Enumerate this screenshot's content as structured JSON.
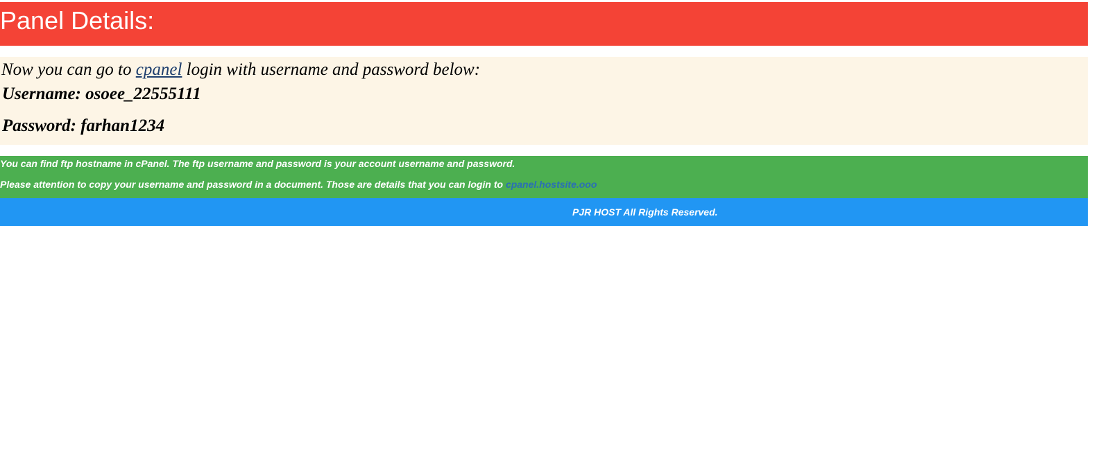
{
  "header": {
    "title": "Panel Details:"
  },
  "info": {
    "intro_prefix": "Now you can go to ",
    "intro_link": "cpanel",
    "intro_suffix": " login with username and password below:",
    "username_line": "Username: osoee_22555111",
    "password_line": "Password: farhan1234"
  },
  "notice": {
    "line1": "You can find ftp hostname in cPanel. The ftp username and password is your account username and password.",
    "line2_prefix": "Please attention to copy your username and password in a document. Those are details that you can login to ",
    "line2_link": "cpanel.hostsite.ooo"
  },
  "footer": {
    "text": "PJR HOST All Rights Reserved."
  },
  "colors": {
    "header_bg": "#f44336",
    "info_bg": "#fdf5e6",
    "notice_bg": "#4caf50",
    "footer_bg": "#2196f3",
    "link_dark": "#1f3f6e",
    "link_blue": "#2a6fb5"
  }
}
